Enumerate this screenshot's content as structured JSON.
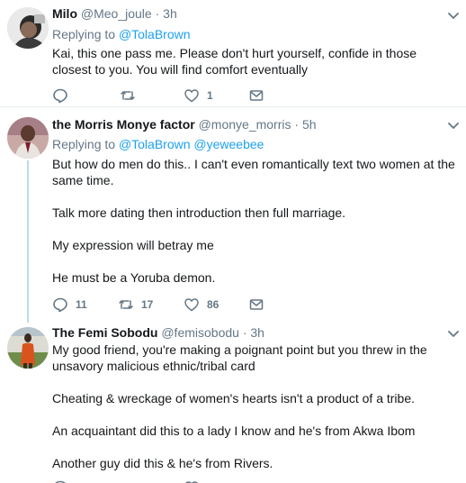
{
  "tweets": [
    {
      "name": "Milo",
      "handle": "@Meo_joule",
      "dot": "·",
      "time": "3h",
      "replying_prefix": "Replying to",
      "replying_to": [
        "@TolaBrown"
      ],
      "body": [
        "Kai, this one pass me. Please don't hurt yourself, confide in those closest to you. You will find comfort eventually"
      ],
      "replies": "",
      "retweets": "",
      "likes": "1"
    },
    {
      "name": "the Morris Monye factor",
      "handle": "@monye_morris",
      "dot": "·",
      "time": "5h",
      "replying_prefix": "Replying to",
      "replying_to": [
        "@TolaBrown",
        "@yeweebee"
      ],
      "body": [
        "But how do men do this.. I can't even romantically text two women at the same time.",
        "Talk more dating then introduction then full marriage.",
        "My expression will betray me",
        "He must be a Yoruba demon."
      ],
      "replies": "11",
      "retweets": "17",
      "likes": "86"
    },
    {
      "name": "The Femi Sobodu",
      "handle": "@femisobodu",
      "dot": "·",
      "time": "3h",
      "body": [
        "My good friend, you're making a poignant point but you threw in the unsavory malicious ethnic/tribal card",
        "Cheating & wreckage of women's hearts isn't a product of a tribe.",
        "An acquaintant did this to a lady I know and he's from Akwa Ibom",
        "Another guy did this & he's from Rivers."
      ]
    }
  ],
  "colors": {
    "link": "#1da1f2",
    "muted": "#657786",
    "thread_line": "#b7dcf5",
    "divider": "#e6ecf0"
  },
  "icons": [
    "reply-icon",
    "retweet-icon",
    "like-icon",
    "dm-icon",
    "chevron-down-icon"
  ]
}
